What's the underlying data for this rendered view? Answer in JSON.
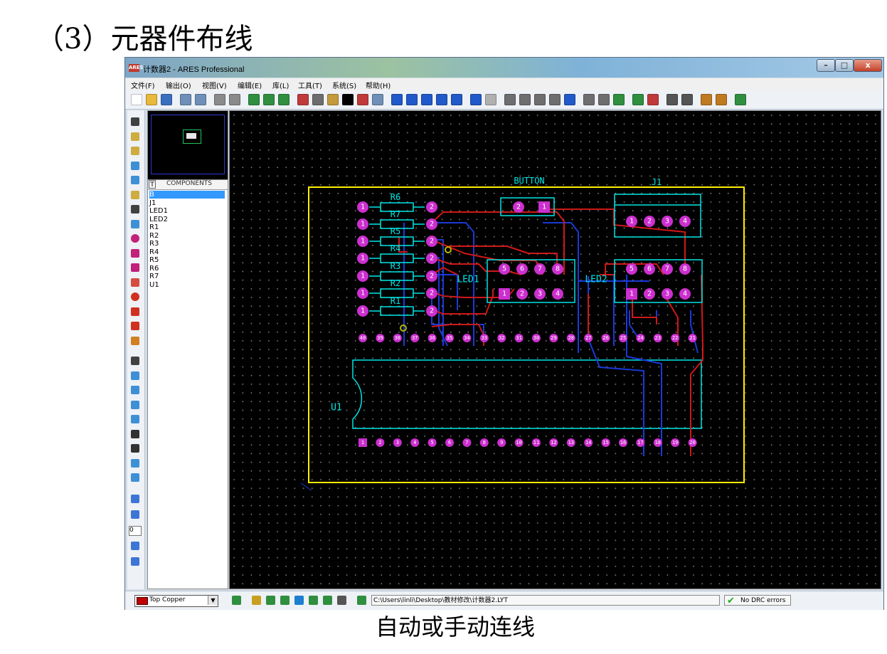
{
  "page": {
    "heading": "（3）元器件布线",
    "caption": "自动或手动连线"
  },
  "window": {
    "title": "计数器2 - ARES Professional",
    "app_icon": "ARES",
    "controls": {
      "minimize": "–",
      "maximize": "□",
      "close": "x"
    }
  },
  "menu": {
    "items": [
      "文件(F)",
      "输出(O)",
      "视图(V)",
      "编辑(E)",
      "库(L)",
      "工具(T)",
      "系统(S)",
      "帮助(H)"
    ]
  },
  "toolbar": {
    "icons": [
      "new-file-icon",
      "open-file-icon",
      "save-icon",
      "import-icon",
      "export-icon",
      "print-icon",
      "print-preview-icon",
      "netlist-icon",
      "bom-icon",
      "refresh-icon",
      "flip-icon",
      "grid-icon",
      "layer-icon",
      "metric-icon",
      "origin-icon",
      "snap-icon",
      "pan-icon",
      "zoom-in-icon",
      "zoom-out-icon",
      "zoom-all-icon",
      "zoom-area-icon",
      "undo-icon",
      "redo-icon",
      "block-copy-icon",
      "block-move-icon",
      "block-rotate-icon",
      "block-delete-icon",
      "pick-icon",
      "package-icon",
      "decompose-icon",
      "autorouter-icon",
      "autoplacer-icon",
      "design-rule-icon",
      "search-icon",
      "tag-icon",
      "ratsnest-icon",
      "connectivity-icon",
      "pcb-3d-icon"
    ],
    "colors": [
      "#ffffff",
      "#e8b93c",
      "#3a6fbf",
      "#6e8fb8",
      "#6e8fb8",
      "#8a8a8a",
      "#8a8a8a",
      "#2f8f3f",
      "#2f8f3f",
      "#2f8f3f",
      "#c03a3a",
      "#6e6e6e",
      "#c49a3a",
      "#000000",
      "#c03a3a",
      "#6e8fb8",
      "#2059c9",
      "#2059c9",
      "#2059c9",
      "#2059c9",
      "#2059c9",
      "#2059c9",
      "#b0b0b0",
      "#6e6e6e",
      "#6e6e6e",
      "#6e6e6e",
      "#6e6e6e",
      "#2059c9",
      "#6e6e6e",
      "#6e6e6e",
      "#2f8f3f",
      "#2f8f3f",
      "#c03a3a",
      "#555555",
      "#555555",
      "#c07a20",
      "#c07a20",
      "#2f8f3f"
    ]
  },
  "left_tools": {
    "icons": [
      "selection-icon",
      "component-icon",
      "package-icon",
      "track-icon",
      "via-icon",
      "zone-icon",
      "ratsnest-icon",
      "connectivity-icon",
      "round-pad-icon",
      "square-pad-icon",
      "dil-pad-icon",
      "edge-pad-icon",
      "circle-pad-icon",
      "rect-pad-icon",
      "polygon-pad-icon",
      "padstack-icon",
      "line-icon",
      "box-icon",
      "circle-icon",
      "arc-icon",
      "path-icon",
      "text-icon",
      "symbol-icon",
      "marker-icon",
      "dimension-icon",
      "rotate-cw-icon",
      "rotate-ccw-icon",
      "angle-input",
      "mirror-x-icon",
      "mirror-y-icon"
    ],
    "angle_value": "0"
  },
  "components": {
    "mode": "T",
    "title": "COMPONENTS",
    "items": [
      "B",
      "J1",
      "LED1",
      "LED2",
      "R1",
      "R2",
      "R3",
      "R4",
      "R5",
      "R6",
      "R7",
      "U1"
    ],
    "selected_index": 0
  },
  "pcb": {
    "colors": {
      "board_edge": "#ffee00",
      "silkscreen": "#00e5e5",
      "pad": "#cc2fcf",
      "pad_text": "#ffffff",
      "top_copper": "#d01818",
      "bottom_copper": "#1a3ad8",
      "via": "#b8b800"
    },
    "labels": {
      "button": "BUTTON",
      "j1": "J1",
      "led1": "LED1",
      "led2": "LED2",
      "u1": "U1"
    },
    "resistors": [
      "R6",
      "R7",
      "R5",
      "R4",
      "R3",
      "R2",
      "R1"
    ],
    "resistor_pad_left": "1",
    "resistor_pad_right": "2",
    "button_pads": [
      "2",
      "1"
    ],
    "j1_pads": [
      "1",
      "2",
      "3",
      "4"
    ],
    "led_pads_top": [
      "5",
      "6",
      "7",
      "8"
    ],
    "led_pads_bottom": [
      "1",
      "2",
      "3",
      "4"
    ],
    "u1_pins_top": [
      "40",
      "39",
      "38",
      "37",
      "36",
      "35",
      "34",
      "33",
      "32",
      "31",
      "30",
      "29",
      "28",
      "27",
      "26",
      "25",
      "24",
      "23",
      "22",
      "21"
    ],
    "u1_pins_bottom": [
      "1",
      "2",
      "3",
      "4",
      "5",
      "6",
      "7",
      "8",
      "9",
      "10",
      "11",
      "12",
      "13",
      "14",
      "15",
      "16",
      "17",
      "18",
      "19",
      "20"
    ]
  },
  "status": {
    "layer": "Top Copper",
    "layer_color": "#c00000",
    "layer_dropdown_icon": "chevron-down-icon",
    "path": "C:\\Users\\linli\\Desktop\\教材修改\\计数器2.LYT",
    "drc": "No DRC errors",
    "drc_icon": "checkmark-icon",
    "drc_color": "#19b019"
  }
}
